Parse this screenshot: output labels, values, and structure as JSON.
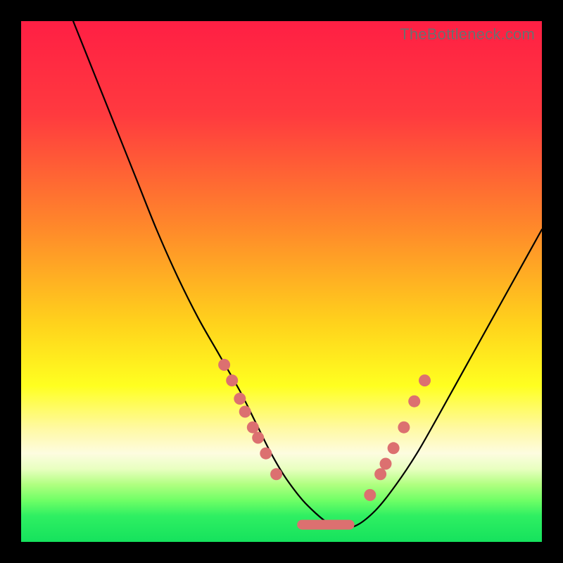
{
  "watermark": "TheBottleneck.com",
  "chart_data": {
    "type": "line",
    "title": "",
    "xlabel": "",
    "ylabel": "",
    "xlim": [
      0,
      100
    ],
    "ylim": [
      0,
      100
    ],
    "gradient_stops": [
      {
        "offset": 0,
        "color": "#ff1f44"
      },
      {
        "offset": 18,
        "color": "#ff3a3f"
      },
      {
        "offset": 40,
        "color": "#ff8a2a"
      },
      {
        "offset": 58,
        "color": "#ffd21c"
      },
      {
        "offset": 70,
        "color": "#ffff20"
      },
      {
        "offset": 78,
        "color": "#fff9a0"
      },
      {
        "offset": 83,
        "color": "#fdfce0"
      },
      {
        "offset": 86,
        "color": "#e8ffc0"
      },
      {
        "offset": 89,
        "color": "#b0ff80"
      },
      {
        "offset": 92,
        "color": "#70ff66"
      },
      {
        "offset": 95,
        "color": "#2fef62"
      },
      {
        "offset": 100,
        "color": "#15e25d"
      }
    ],
    "series": [
      {
        "name": "bottleneck-curve",
        "x": [
          10,
          14,
          18,
          22,
          26,
          30,
          34,
          38,
          42,
          45,
          48,
          51,
          55,
          60,
          64,
          68,
          72,
          76,
          80,
          85,
          90,
          95,
          100
        ],
        "y": [
          100,
          90,
          80,
          70,
          60,
          51,
          43,
          36,
          29,
          23,
          17,
          12,
          7,
          3,
          3,
          6,
          11,
          17,
          24,
          33,
          42,
          51,
          60
        ]
      }
    ],
    "markers": {
      "name": "highlight-points",
      "color": "#dc7070",
      "points": [
        {
          "x": 39.0,
          "y": 34.0
        },
        {
          "x": 40.5,
          "y": 31.0
        },
        {
          "x": 42.0,
          "y": 27.5
        },
        {
          "x": 43.0,
          "y": 25.0
        },
        {
          "x": 44.5,
          "y": 22.0
        },
        {
          "x": 45.5,
          "y": 20.0
        },
        {
          "x": 47.0,
          "y": 17.0
        },
        {
          "x": 49.0,
          "y": 13.0
        },
        {
          "x": 67.0,
          "y": 9.0
        },
        {
          "x": 69.0,
          "y": 13.0
        },
        {
          "x": 70.0,
          "y": 15.0
        },
        {
          "x": 71.5,
          "y": 18.0
        },
        {
          "x": 73.5,
          "y": 22.0
        },
        {
          "x": 75.5,
          "y": 27.0
        },
        {
          "x": 77.5,
          "y": 31.0
        }
      ],
      "flat_segment": {
        "x1": 53,
        "x2": 64,
        "y": 3.3
      }
    }
  }
}
